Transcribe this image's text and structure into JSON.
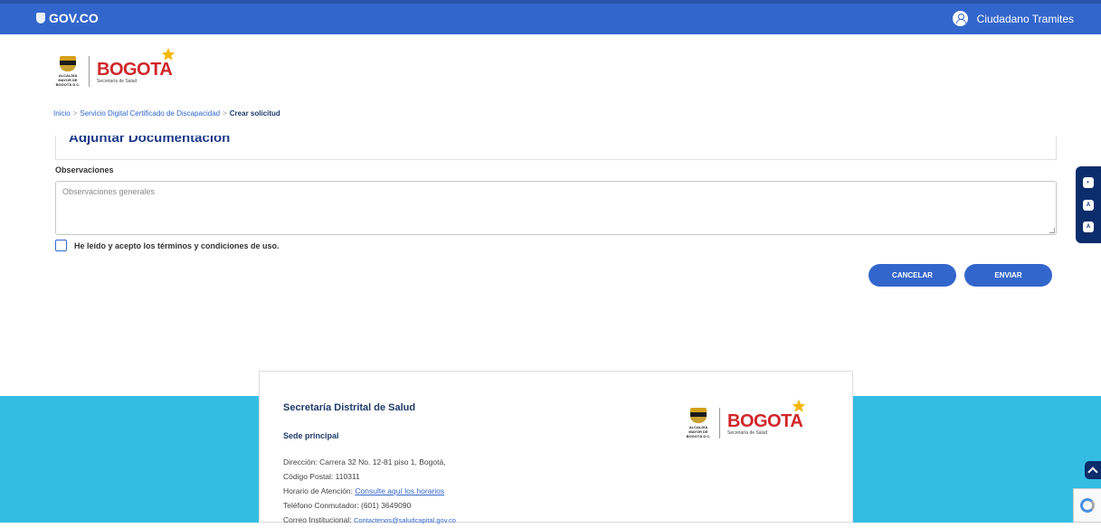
{
  "topbar": {
    "brand": "GOV.CO",
    "user_name": "Ciudadano Tramites"
  },
  "logo": {
    "alcaldia": "ALCALDÍA MAYOR DE BOGOTÁ D.C.",
    "city": "BOGOTA",
    "dept": "Secretaría de Salud"
  },
  "breadcrumb": {
    "items": [
      "Inicio",
      "Servicio Digital Certificado de Discapacidad",
      "Crear solicitud"
    ],
    "separator": ">"
  },
  "section": {
    "title": "Adjuntar Documentación"
  },
  "form": {
    "obs_label": "Observaciones",
    "obs_placeholder": "Observaciones generales",
    "terms_label": "He leído y acepto los términos y condiciones de uso.",
    "cancel_label": "CANCELAR",
    "send_label": "ENVIAR"
  },
  "footer": {
    "title": "Secretaría Distrital de Salud",
    "subtitle": "Sede principal",
    "address": "Dirección: Carrera 32 No. 12-81 piso 1, Bogotá,",
    "postal": "Código Postal: 110311",
    "hours_prefix": "Horario de Atención: ",
    "hours_link": "Consulte aquí los horarios",
    "phone": "Teléfono Conmutador: (601) 3649090",
    "email_prefix": "Correo Institucional: ",
    "email": "Contactenos@saludcapital.gov.co"
  },
  "colors": {
    "primary": "#3366cc",
    "footer_band": "#33bde3",
    "a11y_panel": "#0b2d6b",
    "logo_red": "#d0262a"
  }
}
